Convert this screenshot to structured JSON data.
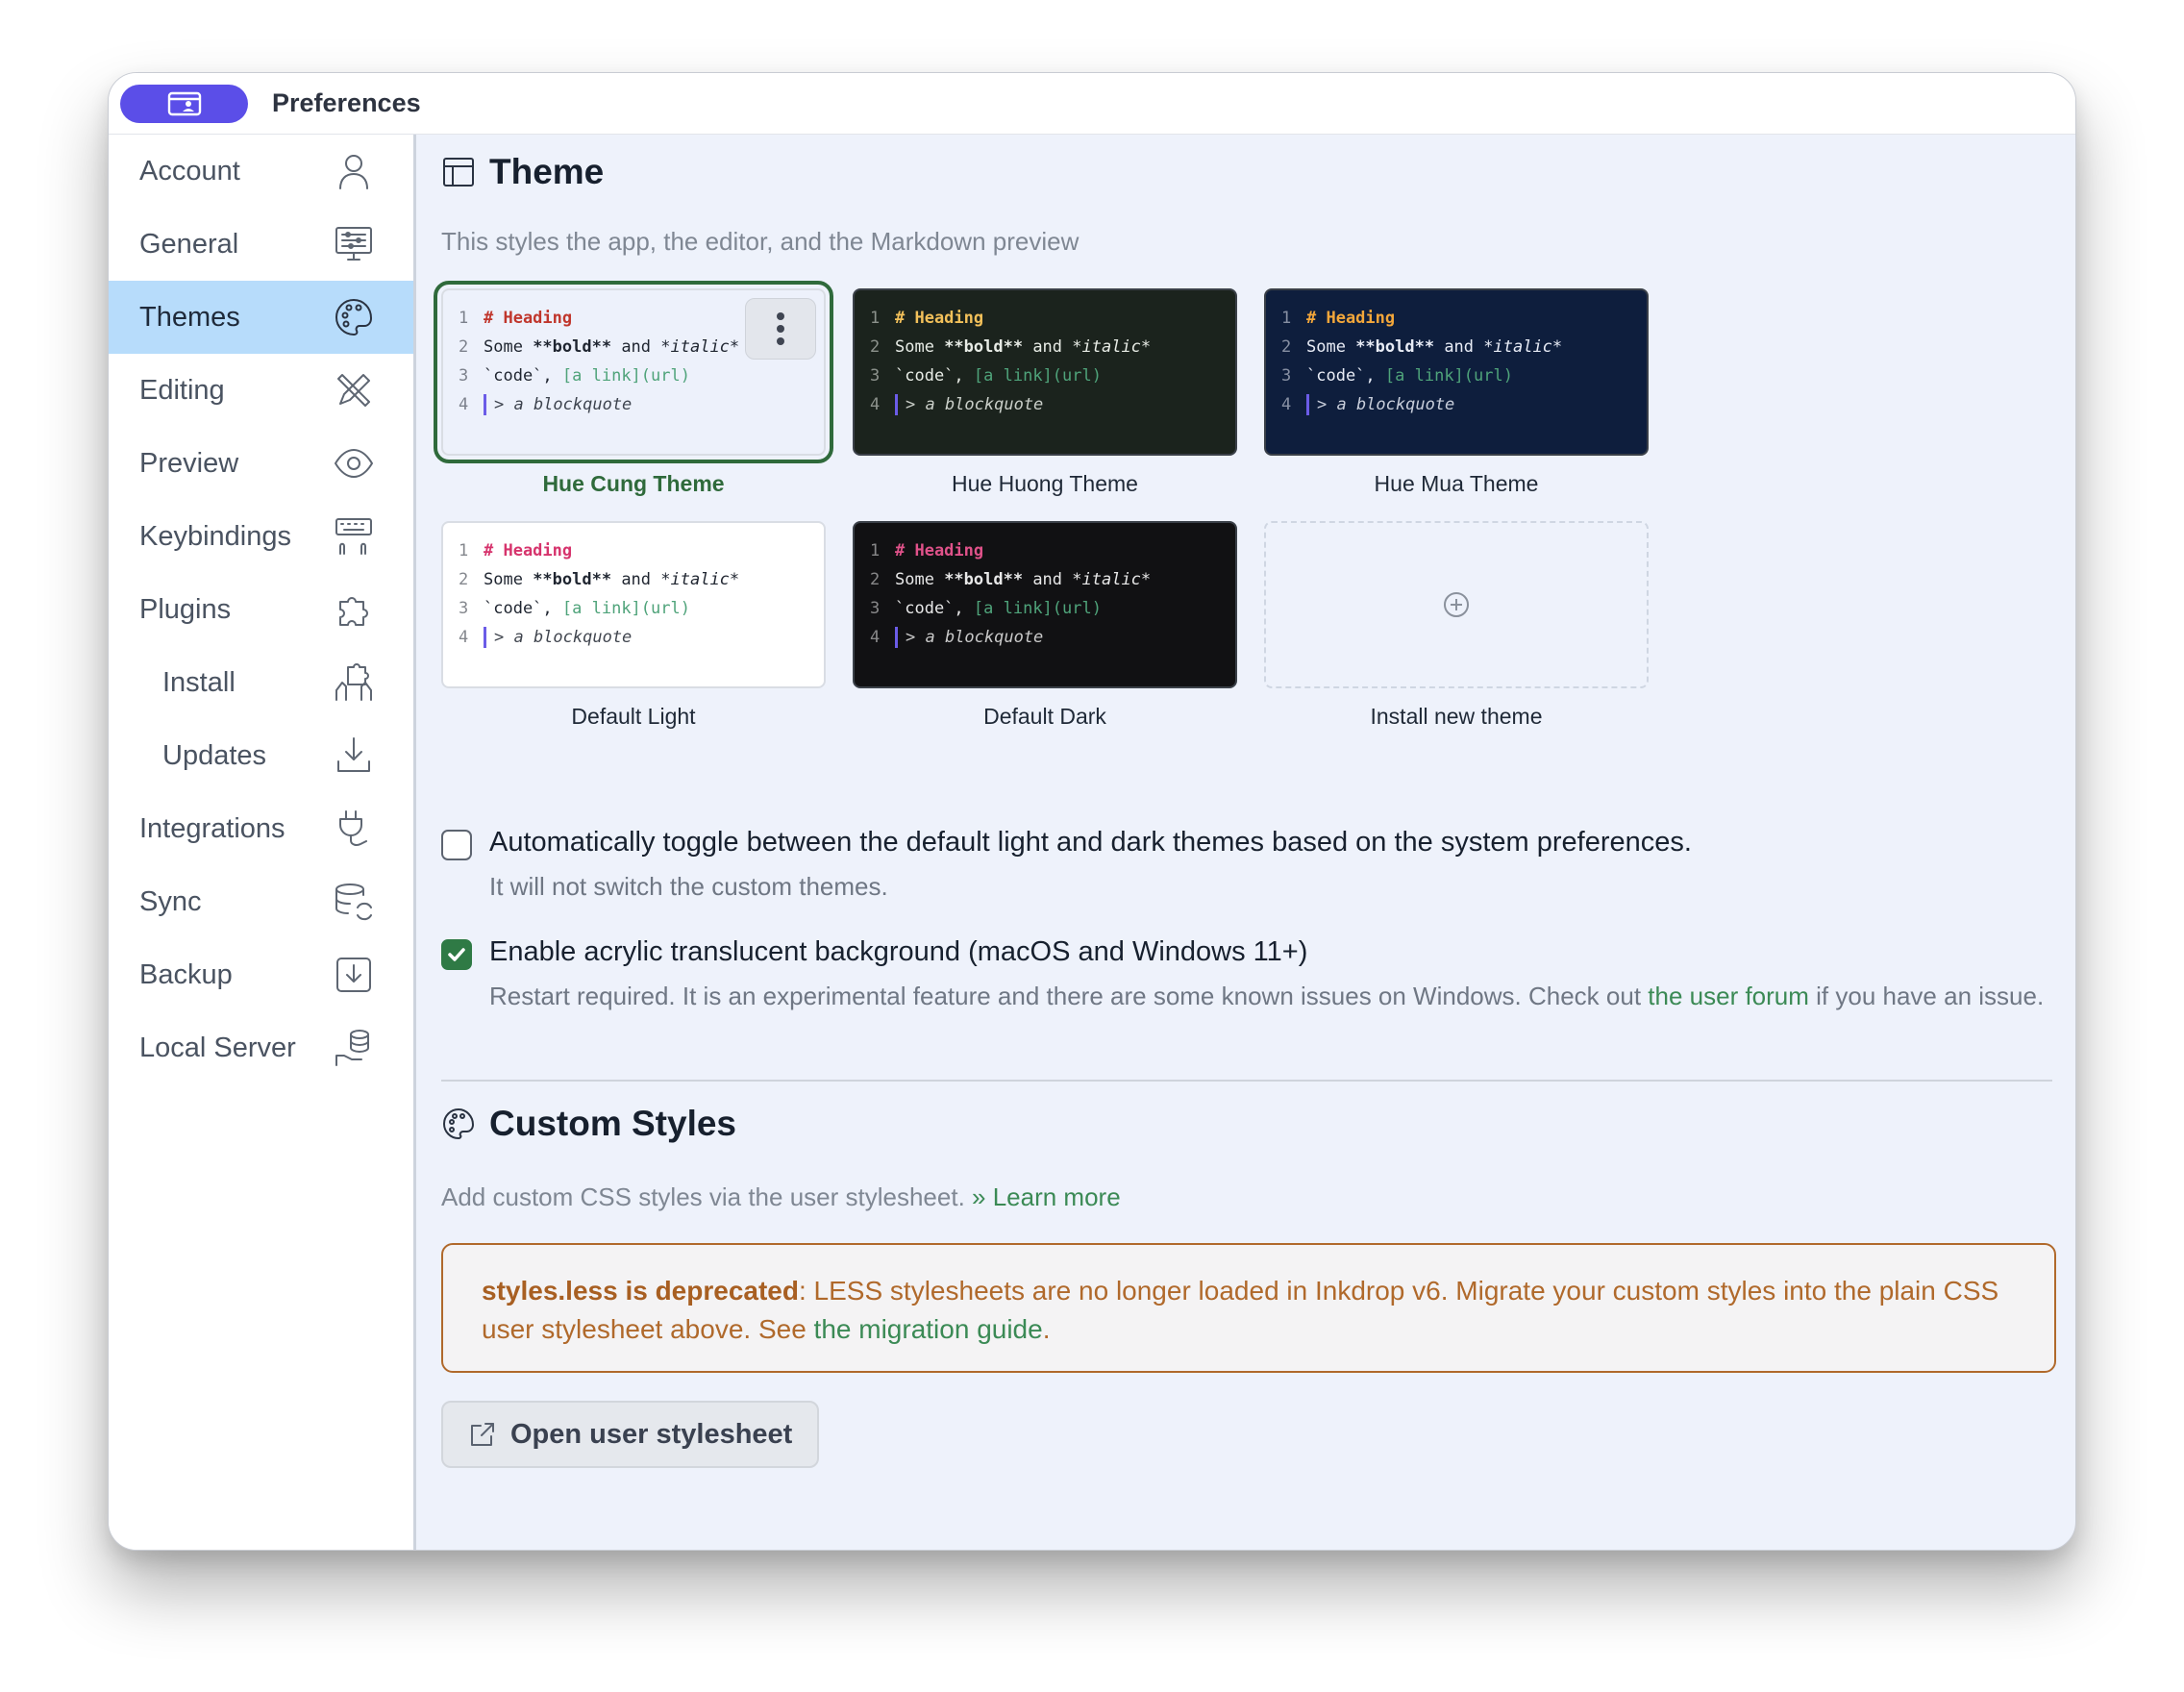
{
  "window": {
    "title": "Preferences"
  },
  "sidebar": {
    "items": [
      {
        "label": "Account",
        "icon": "user-icon"
      },
      {
        "label": "General",
        "icon": "monitor-sliders-icon"
      },
      {
        "label": "Themes",
        "icon": "palette-icon",
        "active": true
      },
      {
        "label": "Editing",
        "icon": "pencil-ruler-icon"
      },
      {
        "label": "Preview",
        "icon": "eye-icon"
      },
      {
        "label": "Keybindings",
        "icon": "keyboard-icon"
      },
      {
        "label": "Plugins",
        "icon": "puzzle-icon"
      },
      {
        "label": "Install",
        "icon": "hand-puzzle-icon",
        "sub": true
      },
      {
        "label": "Updates",
        "icon": "download-icon",
        "sub": true
      },
      {
        "label": "Integrations",
        "icon": "plug-icon"
      },
      {
        "label": "Sync",
        "icon": "database-sync-icon"
      },
      {
        "label": "Backup",
        "icon": "backup-icon"
      },
      {
        "label": "Local Server",
        "icon": "server-hand-icon"
      }
    ]
  },
  "theme_section": {
    "title": "Theme",
    "description": "This styles the app, the editor, and the Markdown preview",
    "preview_lines": {
      "l1": "# Heading",
      "l2a": "Some ",
      "l2b": "**bold**",
      "l2c": " and ",
      "l2d": "*italic*",
      "l3a": "`code`",
      "l3b": ", ",
      "l3c": "[a link](url)",
      "l4": "> a blockquote",
      "n1": "1",
      "n2": "2",
      "n3": "3",
      "n4": "4"
    },
    "themes": [
      {
        "name": "Hue Cung Theme",
        "selected": true,
        "bg": "#edf1fb",
        "fg": "#1f2530",
        "heading": "#c0362c"
      },
      {
        "name": "Hue Huong Theme",
        "bg": "#1b231d",
        "fg": "#e8ece6",
        "heading": "#f2c05a"
      },
      {
        "name": "Hue Mua Theme",
        "bg": "#0e1e3d",
        "fg": "#e8ecf6",
        "heading": "#f4a73a"
      },
      {
        "name": "Default Light",
        "bg": "#ffffff",
        "fg": "#1f2530",
        "heading": "#d6336c"
      },
      {
        "name": "Default Dark",
        "bg": "#111113",
        "fg": "#e8e8e8",
        "heading": "#e0528a"
      }
    ],
    "install_label": "Install new theme"
  },
  "options": {
    "auto_toggle": {
      "label": "Automatically toggle between the default light and dark themes based on the system preferences.",
      "desc": "It will not switch the custom themes.",
      "checked": false
    },
    "acrylic": {
      "label": "Enable acrylic translucent background (macOS and Windows 11+)",
      "desc_before": "Restart required. It is an experimental feature and there are some known issues on Windows. Check out ",
      "desc_link": "the user forum",
      "desc_after": " if you have an issue.",
      "checked": true
    }
  },
  "custom_styles": {
    "title": "Custom Styles",
    "desc": "Add custom CSS styles via the user stylesheet.",
    "learn_more": "» Learn more",
    "warning_bold": "styles.less is deprecated",
    "warning_text": ": LESS stylesheets are no longer loaded in Inkdrop v6. Migrate your custom styles into the plain CSS user stylesheet above. See ",
    "warning_link": "the migration guide",
    "warning_end": ".",
    "button_label": "Open user stylesheet"
  },
  "colors": {
    "accent": "#5b4ee8",
    "selected": "#2f6a3b",
    "link": "#3b8a55",
    "warning": "#b0692b",
    "sidebar_active": "#b7dcfb"
  }
}
